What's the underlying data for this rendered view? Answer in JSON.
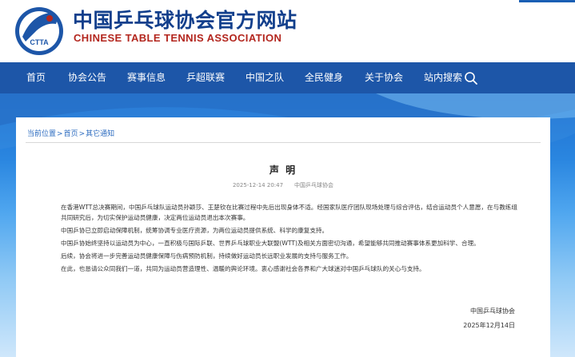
{
  "header": {
    "title_cn": "中国乒乓球协会官方网站",
    "title_en": "CHINESE TABLE TENNIS ASSOCIATION",
    "logo_text": "CTTA",
    "brand_color": "#1d56a8",
    "accent_color": "#b3261e"
  },
  "nav": {
    "items": [
      {
        "label": "首页"
      },
      {
        "label": "协会公告"
      },
      {
        "label": "赛事信息"
      },
      {
        "label": "乒超联赛"
      },
      {
        "label": "中国之队"
      },
      {
        "label": "全民健身"
      },
      {
        "label": "关于协会"
      },
      {
        "label": "站内搜索"
      }
    ],
    "search_icon": "search-icon"
  },
  "breadcrumb": {
    "current": "当前位置",
    "home": "首页",
    "section": "其它通知",
    "separator": ">"
  },
  "article": {
    "title": "声 明",
    "date": "2025-12-14 20:47",
    "source": "中国乒乓球协会",
    "paragraphs": [
      "在香港WTT总决赛期间，中国乒乓球队运动员孙颖莎、王楚钦在比赛过程中先后出现身体不适。经国家队医疗团队现场处理与综合评估，结合运动员个人意愿，在与教练组共同研究后，为切实保护运动员健康，决定两位运动员退出本次赛事。",
      "中国乒协已立即启动保障机制，统筹协调专业医疗资源，为两位运动员提供系统、科学的康复支持。",
      "中国乒协始终坚持以运动员为中心，一直积极与国际乒联、世界乒乓球职业大联盟(WTT)及相关方面密切沟通，希望能够共同推动赛事体系更加科学、合理。",
      "后续，协会将进一步完善运动员健康保障与伤病预防机制，持续做好运动员长远职业发展的支持与服务工作。",
      "在此，也恳请公众同我们一道，共同为运动员营造理性、温暖的舆论环境。衷心感谢社会各界和广大球迷对中国乒乓球队的关心与支持。"
    ],
    "signature_org": "中国乒乓球协会",
    "signature_date": "2025年12月14日"
  }
}
